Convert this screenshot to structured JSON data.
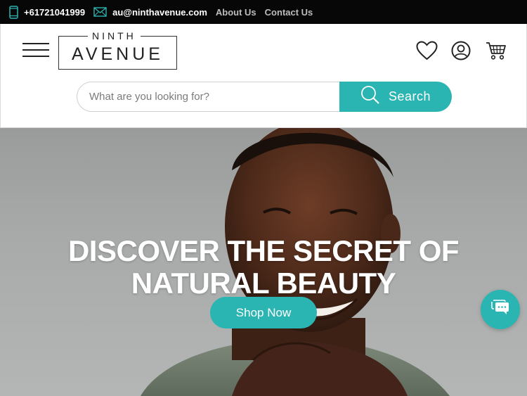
{
  "topbar": {
    "phone": "+61721041999",
    "email": "au@ninthavenue.com",
    "links": [
      "About Us",
      "Contact Us"
    ],
    "icons": {
      "phone": "mobile-phone-icon",
      "email": "envelope-icon"
    }
  },
  "header": {
    "logo": {
      "top": "NINTH",
      "bottom": "AVENUE"
    },
    "icons": [
      "menu-icon",
      "heart-icon",
      "user-icon",
      "cart-icon"
    ]
  },
  "search": {
    "placeholder": "What are you looking for?",
    "button_label": "Search"
  },
  "hero": {
    "headline_line1": "DISCOVER THE SECRET OF",
    "headline_line2": "NATURAL BEAUTY",
    "cta_label": "Shop Now"
  },
  "chat": {
    "icon": "chat-bubble-icon"
  },
  "colors": {
    "accent": "#2bb5b2",
    "topbar": "#070707",
    "muted_link": "#bdbdbd"
  }
}
